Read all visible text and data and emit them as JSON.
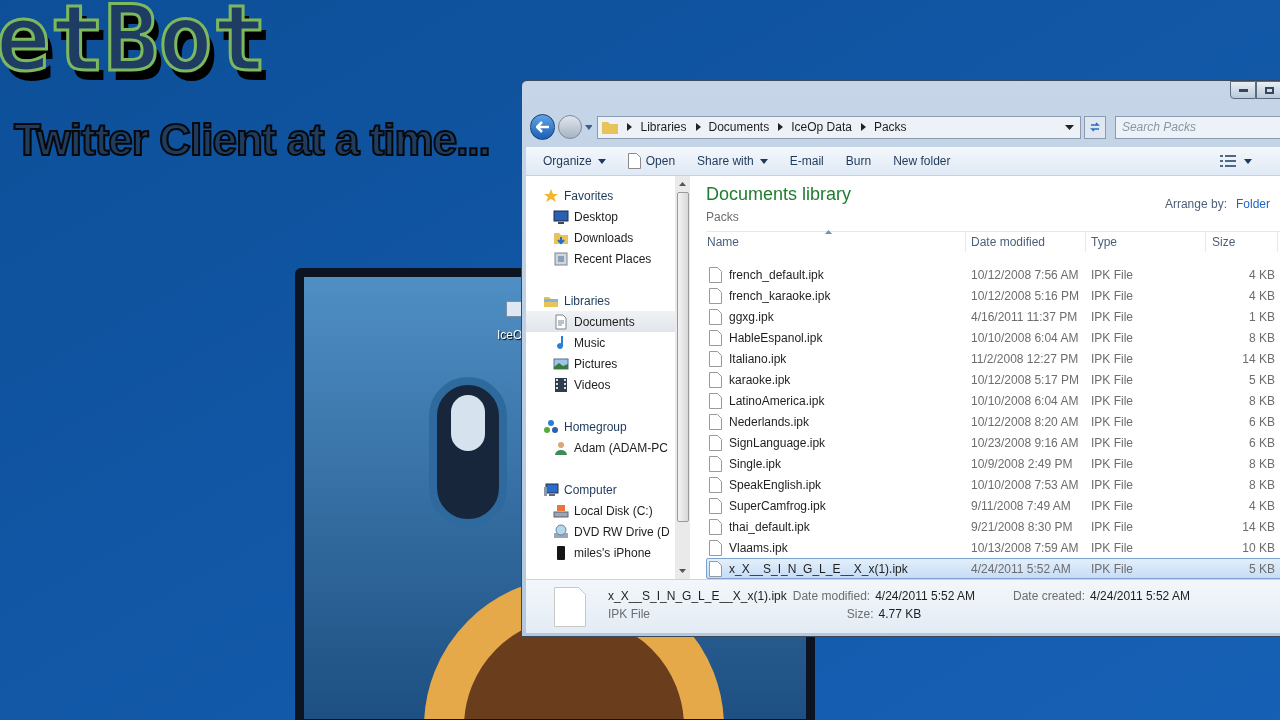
{
  "desktop": {
    "logo_text": "etBot",
    "tagline": "Twitter Client at a time...",
    "icon_label": "IceO"
  },
  "window": {
    "breadcrumb": [
      "Libraries",
      "Documents",
      "IceOp Data",
      "Packs"
    ],
    "search": {
      "placeholder": "Search Packs"
    },
    "toolbar": [
      {
        "label": "Organize",
        "kind": "dropdown"
      },
      {
        "label": "Open",
        "kind": "icon"
      },
      {
        "label": "Share with",
        "kind": "dropdown"
      },
      {
        "label": "E-mail",
        "kind": "plain"
      },
      {
        "label": "Burn",
        "kind": "plain"
      },
      {
        "label": "New folder",
        "kind": "plain"
      }
    ],
    "sidebar": [
      {
        "label": "Favorites",
        "selected": false,
        "children": [
          {
            "label": "Desktop",
            "selected": false
          },
          {
            "label": "Downloads",
            "selected": false
          },
          {
            "label": "Recent Places",
            "selected": false
          }
        ]
      },
      {
        "label": "Libraries",
        "selected": false,
        "children": [
          {
            "label": "Documents",
            "selected": true
          },
          {
            "label": "Music",
            "selected": false
          },
          {
            "label": "Pictures",
            "selected": false
          },
          {
            "label": "Videos",
            "selected": false
          }
        ]
      },
      {
        "label": "Homegroup",
        "selected": false,
        "children": [
          {
            "label": "Adam (ADAM-PC",
            "selected": false
          }
        ]
      },
      {
        "label": "Computer",
        "selected": false,
        "children": [
          {
            "label": "Local Disk (C:)",
            "selected": false
          },
          {
            "label": "DVD RW Drive (D",
            "selected": false
          },
          {
            "label": "miles's iPhone",
            "selected": false
          }
        ]
      }
    ],
    "library": {
      "title": "Documents library",
      "subtitle": "Packs",
      "arrange_label": "Arrange by:",
      "arrange_value": "Folder"
    },
    "table": {
      "columns": [
        "Name",
        "Date modified",
        "Type",
        "Size"
      ],
      "rows": [
        {
          "name": "french_default.ipk",
          "date": "10/12/2008 7:56 AM",
          "type": "IPK File",
          "size": "4 KB",
          "selected": false
        },
        {
          "name": "french_karaoke.ipk",
          "date": "10/12/2008 5:16 PM",
          "type": "IPK File",
          "size": "4 KB",
          "selected": false
        },
        {
          "name": "ggxg.ipk",
          "date": "4/16/2011 11:37 PM",
          "type": "IPK File",
          "size": "1 KB",
          "selected": false
        },
        {
          "name": "HableEspanol.ipk",
          "date": "10/10/2008 6:04 AM",
          "type": "IPK File",
          "size": "8 KB",
          "selected": false
        },
        {
          "name": "Italiano.ipk",
          "date": "11/2/2008 12:27 PM",
          "type": "IPK File",
          "size": "14 KB",
          "selected": false
        },
        {
          "name": "karaoke.ipk",
          "date": "10/12/2008 5:17 PM",
          "type": "IPK File",
          "size": "5 KB",
          "selected": false
        },
        {
          "name": "LatinoAmerica.ipk",
          "date": "10/10/2008 6:04 AM",
          "type": "IPK File",
          "size": "8 KB",
          "selected": false
        },
        {
          "name": "Nederlands.ipk",
          "date": "10/12/2008 8:20 AM",
          "type": "IPK File",
          "size": "6 KB",
          "selected": false
        },
        {
          "name": "SignLanguage.ipk",
          "date": "10/23/2008 9:16 AM",
          "type": "IPK File",
          "size": "6 KB",
          "selected": false
        },
        {
          "name": "Single.ipk",
          "date": "10/9/2008 2:49 PM",
          "type": "IPK File",
          "size": "8 KB",
          "selected": false
        },
        {
          "name": "SpeakEnglish.ipk",
          "date": "10/10/2008 7:53 AM",
          "type": "IPK File",
          "size": "8 KB",
          "selected": false
        },
        {
          "name": "SuperCamfrog.ipk",
          "date": "9/11/2008 7:49 AM",
          "type": "IPK File",
          "size": "4 KB",
          "selected": false
        },
        {
          "name": "thai_default.ipk",
          "date": "9/21/2008 8:30 PM",
          "type": "IPK File",
          "size": "14 KB",
          "selected": false
        },
        {
          "name": "Vlaams.ipk",
          "date": "10/13/2008 7:59 AM",
          "type": "IPK File",
          "size": "10 KB",
          "selected": false
        },
        {
          "name": "x_X__S_I_N_G_L_E__X_x(1).ipk",
          "date": "4/24/2011 5:52 AM",
          "type": "IPK File",
          "size": "5 KB",
          "selected": true
        }
      ]
    },
    "details": {
      "name": "x_X__S_I_N_G_L_E__X_x(1).ipk",
      "type": "IPK File",
      "fields": [
        {
          "label": "Date modified:",
          "value": "4/24/2011 5:52 AM"
        },
        {
          "label": "Size:",
          "value": "4.77 KB"
        },
        {
          "label": "Date created:",
          "value": "4/24/2011 5:52 AM"
        }
      ]
    }
  }
}
